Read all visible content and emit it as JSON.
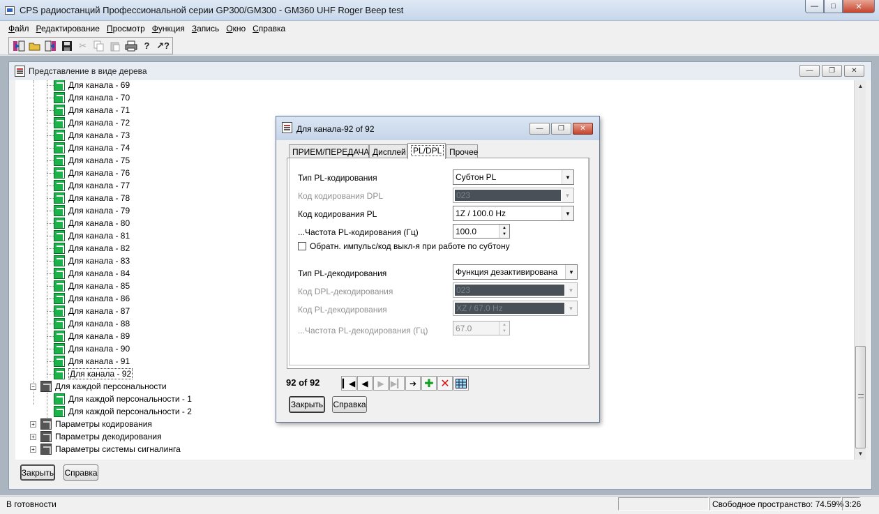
{
  "window": {
    "title": "CPS радиостанций Профессиональной серии GP300/GM300 - GM360 UHF Roger Beep test"
  },
  "menu": [
    "Файл",
    "Редактирование",
    "Просмотр",
    "Функция",
    "Запись",
    "Окно",
    "Справка"
  ],
  "tree_window": {
    "title": "Представление в виде дерева",
    "channels": [
      "Для канала - 69",
      "Для канала - 70",
      "Для канала - 71",
      "Для канала - 72",
      "Для канала - 73",
      "Для канала - 74",
      "Для канала - 75",
      "Для канала - 76",
      "Для канала - 77",
      "Для канала - 78",
      "Для канала - 79",
      "Для канала - 80",
      "Для канала - 81",
      "Для канала - 82",
      "Для канала - 83",
      "Для канала - 84",
      "Для канала - 85",
      "Для канала - 86",
      "Для канала - 87",
      "Для канала - 88",
      "Для канала - 89",
      "Для канала - 90",
      "Для канала - 91",
      "Для канала - 92"
    ],
    "personality_group": "Для каждой персональности",
    "personalities": [
      "Для каждой персональности - 1",
      "Для каждой персональности - 2"
    ],
    "encode_params": "Параметры кодирования",
    "decode_params": "Параметры  декодирования",
    "signaling_params": "Параметры системы сигналинга",
    "close_label": "Закрыть",
    "help_label": "Справка"
  },
  "dialog": {
    "title": "Для канала-92 of 92",
    "tabs": [
      "ПРИЕМ/ПЕРЕДАЧА",
      "Дисплей",
      "PL/DPL",
      "Прочее"
    ],
    "active_tab": "PL/DPL",
    "pl_encode_type_label": "Тип PL-кодирования",
    "pl_encode_type_value": "Субтон PL",
    "dpl_encode_code_label": "Код кодирования DPL",
    "dpl_encode_code_value": "023",
    "pl_encode_code_label": "Код кодирования PL",
    "pl_encode_code_value": "1Z / 100.0 Hz",
    "pl_encode_freq_label": "...Частота PL-кодирования (Гц)",
    "pl_encode_freq_value": "100.0",
    "reverse_burst_label": "Обратн. импульс/код выкл-я при работе по субтону",
    "reverse_burst_checked": false,
    "pl_decode_type_label": "Тип PL-декодирования",
    "pl_decode_type_value": "Функция дезактивирована",
    "dpl_decode_code_label": "Код DPL-декодирования",
    "dpl_decode_code_value": "023",
    "pl_decode_code_label": "Код PL-декодирования",
    "pl_decode_code_value": "XZ / 67.0 Hz",
    "pl_decode_freq_label": "...Частота PL-декодирования (Гц)",
    "pl_decode_freq_value": "67.0",
    "record_counter": "92 of 92",
    "close_label": "Закрыть",
    "help_label": "Справка"
  },
  "status": {
    "ready": "В готовности",
    "free_space": "Свободное пространство: 74.59%",
    "time": "3:26"
  },
  "icons": [
    "open-new-icon",
    "folder-open-icon",
    "read-radio-icon",
    "save-icon",
    "cut-icon",
    "copy-icon",
    "paste-icon",
    "print-icon",
    "help-icon",
    "context-help-icon"
  ]
}
